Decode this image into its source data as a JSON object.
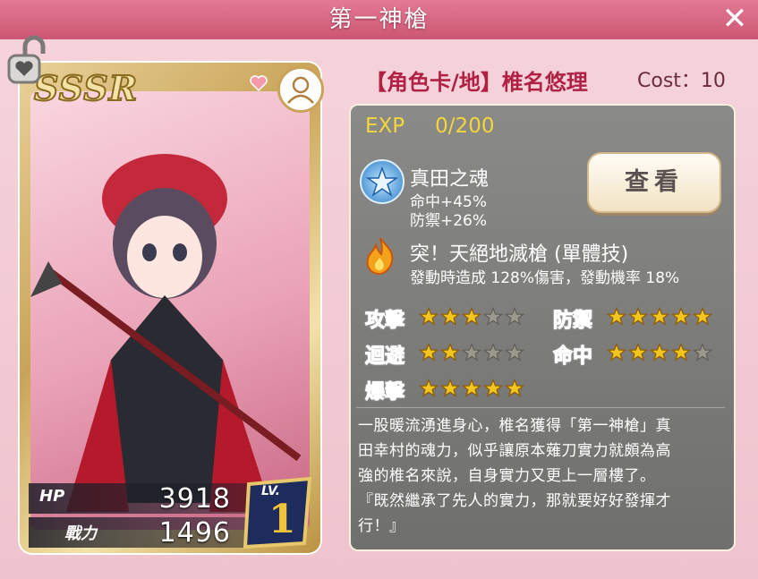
{
  "window": {
    "title": "第一神槍"
  },
  "card": {
    "rarity": "SSSR",
    "hp_label": "HP",
    "hp": "3918",
    "power_label": "戰力",
    "power": "1496",
    "level_label": "LV.",
    "level": "1"
  },
  "header": {
    "name": "【角色卡/地】椎名悠理",
    "cost": "Cost：10"
  },
  "exp": {
    "label": "EXP",
    "value": "0/200"
  },
  "skill1": {
    "name": "真田之魂",
    "line1": "命中+45%",
    "line2": "防禦+26%",
    "view_button": "查看"
  },
  "skill2": {
    "name": "突！天絕地滅槍 (單體技)",
    "desc": "發動時造成 128%傷害，發動機率 18%"
  },
  "attributes": [
    {
      "label": "攻擊",
      "stars": 3,
      "max": 5
    },
    {
      "label": "防禦",
      "stars": 5,
      "max": 5
    },
    {
      "label": "迴避",
      "stars": 2,
      "max": 5
    },
    {
      "label": "命中",
      "stars": 4,
      "max": 5
    },
    {
      "label": "爆擊",
      "stars": 5,
      "max": 5
    }
  ],
  "description": {
    "l1": "一股暖流湧進身心，椎名獲得「第一神槍」真",
    "l2": "田幸村的魂力，似乎讓原本薙刀實力就頗為高",
    "l3": "強的椎名來說，自身實力又更上一層樓了。",
    "l4": "『既然繼承了先人的實力，那就要好好發揮才",
    "l5": "行！』"
  },
  "icons": {
    "close": "close-icon",
    "lock": "lock-icon",
    "avatar": "avatar-icon",
    "heart": "heart-icon",
    "star": "star-icon",
    "fire": "fire-icon"
  },
  "colors": {
    "star_filled": "#f3c51f",
    "star_empty": "#9c9a8f",
    "attr_label": "#d8152f",
    "exp": "#f3d63a",
    "heading": "#b12144"
  }
}
